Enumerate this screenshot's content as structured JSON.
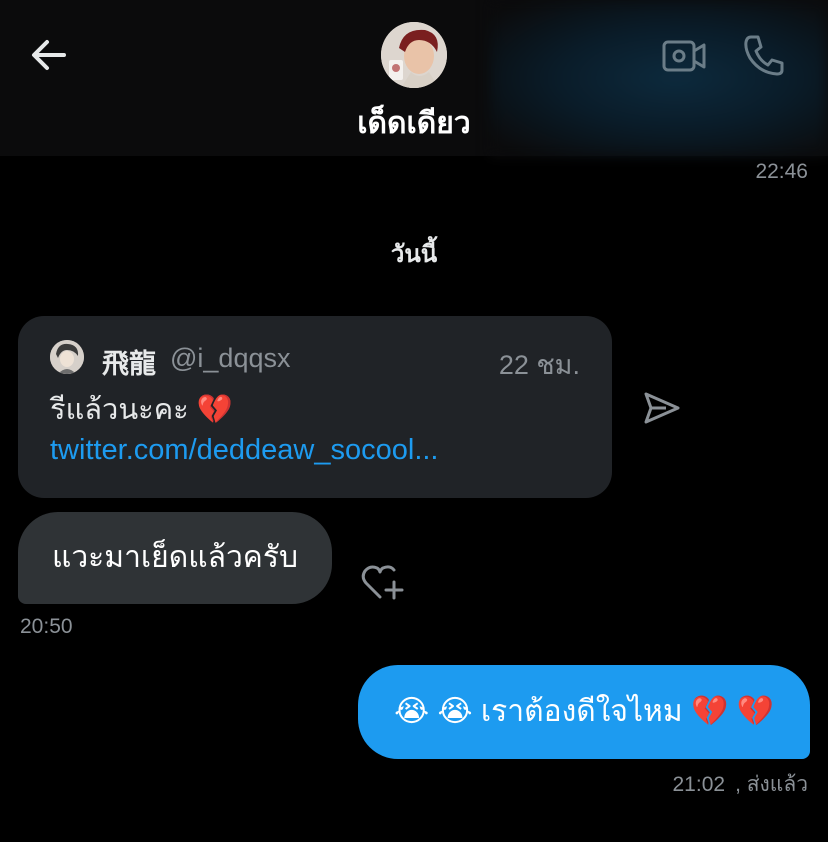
{
  "header": {
    "title": "เด็ดเดียว",
    "back_icon": "arrow-left-icon",
    "video_icon": "video-camera-icon",
    "call_icon": "phone-icon"
  },
  "messages": {
    "top_timestamp": "22:46",
    "day_separator": "วันนี้",
    "quote": {
      "name": "飛龍",
      "handle": "@i_dqqsx",
      "time": "22 ชม.",
      "text": "รีแล้วนะคะ 💔",
      "link": "twitter.com/deddeaw_socool..."
    },
    "received": {
      "text": "แวะมาเย็ดแล้วครับ",
      "time": "20:50"
    },
    "sent": {
      "text": "😭 😭 เราต้องดีใจไหม 💔 💔",
      "time": "21:02",
      "status": ", ส่งแล้ว"
    }
  },
  "colors": {
    "background": "#000000",
    "header": "#0b0b0c",
    "accent": "#1d9bf0",
    "received_bubble": "#2f3336",
    "card": "#202327",
    "muted_text": "#8b9197"
  }
}
